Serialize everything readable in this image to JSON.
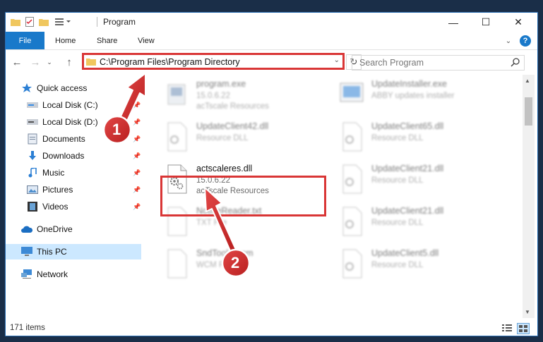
{
  "window": {
    "title": "Program",
    "controls": {
      "minimize": "—",
      "maximize": "☐",
      "close": "✕"
    }
  },
  "ribbon": {
    "tabs": [
      "File",
      "Home",
      "Share",
      "View"
    ],
    "help": "?",
    "accent": "#1979ca"
  },
  "nav": {
    "address": "C:\\Program Files\\Program Directory",
    "search_placeholder": "Search Program"
  },
  "sidebar": {
    "items": [
      {
        "label": "Quick access",
        "icon": "star-icon",
        "pinned": false
      },
      {
        "label": "Local Disk (C:)",
        "icon": "drive-icon",
        "pinned": true
      },
      {
        "label": "Local Disk (D:)",
        "icon": "drive-icon",
        "pinned": true
      },
      {
        "label": "Documents",
        "icon": "documents-icon",
        "pinned": true
      },
      {
        "label": "Downloads",
        "icon": "download-icon",
        "pinned": true
      },
      {
        "label": "Music",
        "icon": "music-icon",
        "pinned": true
      },
      {
        "label": "Pictures",
        "icon": "pictures-icon",
        "pinned": true
      },
      {
        "label": "Videos",
        "icon": "videos-icon",
        "pinned": true
      },
      {
        "label": "OneDrive",
        "icon": "cloud-icon",
        "pinned": false
      },
      {
        "label": "This PC",
        "icon": "computer-icon",
        "pinned": false,
        "selected": true
      },
      {
        "label": "Network",
        "icon": "network-icon",
        "pinned": false
      }
    ]
  },
  "files": [
    {
      "name": "program.exe",
      "line1": "15.0.6.22",
      "line2": "acTscale Resources",
      "icon": "program-icon"
    },
    {
      "name": "UpdateInstaller.exe",
      "line1": "ABBY updates installer",
      "line2": "",
      "icon": "installer-icon"
    },
    {
      "name": "UpdateClient42.dll",
      "line1": "Resource DLL",
      "line2": "",
      "icon": "dll-icon"
    },
    {
      "name": "UpdateClient65.dll",
      "line1": "Resource DLL",
      "line2": "",
      "icon": "dll-icon"
    },
    {
      "name": "actscaleres.dll",
      "line1": "15.0.6.22",
      "line2": "acTscale Resources",
      "icon": "dll-icon",
      "highlighted": true
    },
    {
      "name": "UpdateClient21.dll",
      "line1": "Resource DLL",
      "line2": "",
      "icon": "dll-icon"
    },
    {
      "name": "NotfileReader.txt",
      "line1": "TXT File",
      "line2": "",
      "icon": "text-file-icon"
    },
    {
      "name": "UpdateClient21.dll",
      "line1": "Resource DLL",
      "line2": "",
      "icon": "dll-icon"
    },
    {
      "name": "SndTools.wcm",
      "line1": "WCM File",
      "line2": "",
      "icon": "generic-file-icon"
    },
    {
      "name": "UpdateClient5.dll",
      "line1": "Resource DLL",
      "line2": "",
      "icon": "dll-icon"
    }
  ],
  "status": {
    "count": "171 items"
  },
  "annotations": {
    "marker1": "1",
    "marker2": "2",
    "color": "#d93636"
  }
}
